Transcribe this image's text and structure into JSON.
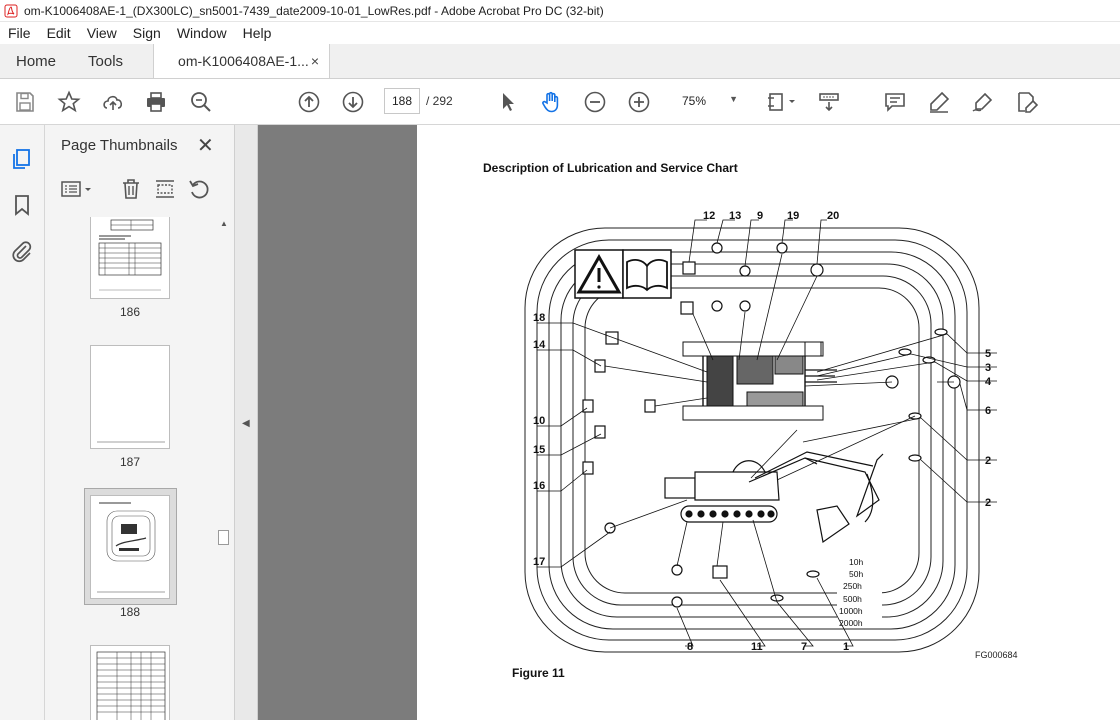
{
  "window": {
    "title": "om-K1006408AE-1_(DX300LC)_sn5001-7439_date2009-10-01_LowRes.pdf - Adobe Acrobat Pro DC (32-bit)"
  },
  "menu": {
    "items": [
      "File",
      "Edit",
      "View",
      "Sign",
      "Window",
      "Help"
    ]
  },
  "tabs": {
    "home": "Home",
    "tools": "Tools",
    "document": "om-K1006408AE-1...",
    "close_glyph": "×"
  },
  "toolbar": {
    "page_current": "188",
    "page_total": "/ 292",
    "zoom": "75%"
  },
  "panel": {
    "title": "Page Thumbnails",
    "close_glyph": "✕",
    "thumbnails": [
      {
        "label": "186"
      },
      {
        "label": "187"
      },
      {
        "label": "188",
        "selected": true
      }
    ]
  },
  "document": {
    "heading": "Description of Lubrication and Service Chart",
    "figure_caption": "Figure 11",
    "figure_code": "FG000684",
    "callouts_top": [
      "12",
      "13",
      "9",
      "19",
      "20"
    ],
    "callouts_left": [
      "18",
      "14",
      "10",
      "15",
      "16",
      "17"
    ],
    "callouts_right": [
      "5",
      "3",
      "4",
      "6",
      "2",
      "2"
    ],
    "callouts_bottom": [
      "8",
      "11",
      "7",
      "1"
    ],
    "interval_labels": [
      "10h",
      "50h",
      "250h",
      "500h",
      "1000h",
      "2000h"
    ]
  }
}
